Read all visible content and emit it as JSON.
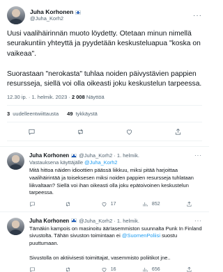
{
  "main_tweet": {
    "display_name": "Juha Korhonen",
    "handle": "@Juha_Korh2",
    "text": "Uusi vaalihäirinnän muoto löydetty. Otetaan minun nimellä seurakuntiin yhteyttä ja pyydetään keskusteluapua \"koska on vaikeaa\".\n\nSuorastaan \"nerokasta\" tuhlaa noiden päivystävien pappien resursseja, siellä voi olla oikeasti joku keskustelun tarpeessa.",
    "time": "12.30 ip. · 1. helmik. 2023 · ",
    "views_count": "2 008",
    "views_label": " Näyttöä"
  },
  "stats": [
    {
      "count": "3",
      "label": "uudelleentwiittausta"
    },
    {
      "count": "49",
      "label": "tykkäystä"
    }
  ],
  "icons": {
    "reply": "reply-icon",
    "retweet": "retweet-icon",
    "like": "heart-icon",
    "share": "share-icon",
    "views": "bar-chart-icon",
    "flag": "finland-flag-icon"
  },
  "replies": [
    {
      "display_name": "Juha Korhonen",
      "handle": "@Juha_Korh2 · 1. helmik.",
      "replying_prefix": "Vastauksena käyttäjälle ",
      "replying_to": "@Juha_Korh2",
      "text_before": "Mitä hittoa näiden idioottien päässä liikkuu, miksi pitää harjoittaa vaalihäirintää ja toiseksesen miksi noiden pappien resursseja tuhlataan liikvaltaan?  Siellä voi ihan oikeasti olla joku epätoivoinen keskustelun tarpeessa.",
      "mention": "",
      "text_after": "",
      "reply_count": "",
      "retweet_count": "",
      "like_count": "17",
      "views_count": "852"
    },
    {
      "display_name": "Juha Korhonen",
      "handle": "@Juha_Korh2 · 1. helmik.",
      "replying_prefix": "",
      "replying_to": "",
      "text_before": "Tämäkin kampois on masinoitu äärIasemmiston suunnalta Punk In Finland sivustolta. Tähän sivuston toimintaan ei ",
      "mention": "@SuomenPoliisi",
      "text_after": " suostu puuttumaan.\n\nSivustolla on aktiivisesti toimittajat, vasemmisto poliitikot jne..",
      "reply_count": "",
      "retweet_count": "",
      "like_count": "16",
      "views_count": "656"
    }
  ]
}
